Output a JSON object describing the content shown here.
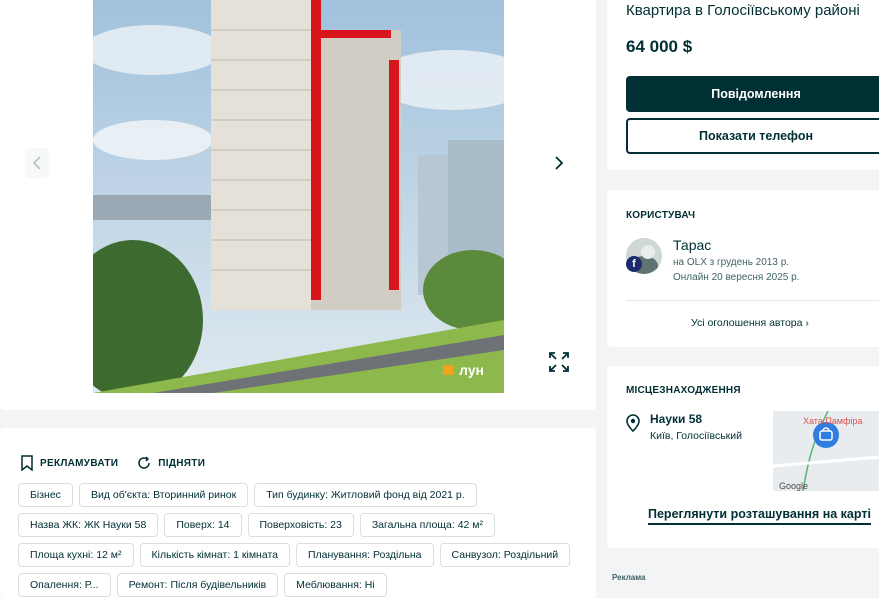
{
  "listing": {
    "title": "Квартира в Голосіївському районі",
    "price": "64 000 $",
    "message_button": "Повідомлення",
    "phone_button": "Показати телефон"
  },
  "gallery": {
    "watermark": "лун"
  },
  "actions": {
    "promote": "РЕКЛАМУВАТИ",
    "raise": "ПІДНЯТИ"
  },
  "tags": [
    "Бізнес",
    "Вид об'єкта: Вторинний ринок",
    "Тип будинку: Житловий фонд від 2021 р.",
    "Назва ЖК: ЖК Науки 58",
    "Поверх: 14",
    "Поверховість: 23",
    "Загальна площа: 42 м²",
    "Площа кухні: 12 м²",
    "Кількість кімнат: 1 кімната",
    "Планування: Роздільна",
    "Санвузол: Роздільний",
    "Опалення: Р...",
    "Ремонт: Після будівельників",
    "Меблювання: Ні"
  ],
  "user": {
    "section_title": "КОРИСТУВАЧ",
    "name": "Тарас",
    "since": "на OLX з грудень 2013 р.",
    "online": "Онлайн 20 вересня 2025 р.",
    "all_ads": "Усі оголошення автора"
  },
  "location": {
    "section_title": "МІСЦЕЗНАХОДЖЕННЯ",
    "street": "Науки 58",
    "city": "Київ, Голосіївський",
    "map_label": "Хата Памфіра",
    "map_brand": "Google",
    "map_link": "Переглянути розташування на карті"
  },
  "ad_label": "Реклама",
  "colors": {
    "brand_dark": "#002f34",
    "accent_red": "#d8141d",
    "map_pin": "#2f7de1"
  }
}
